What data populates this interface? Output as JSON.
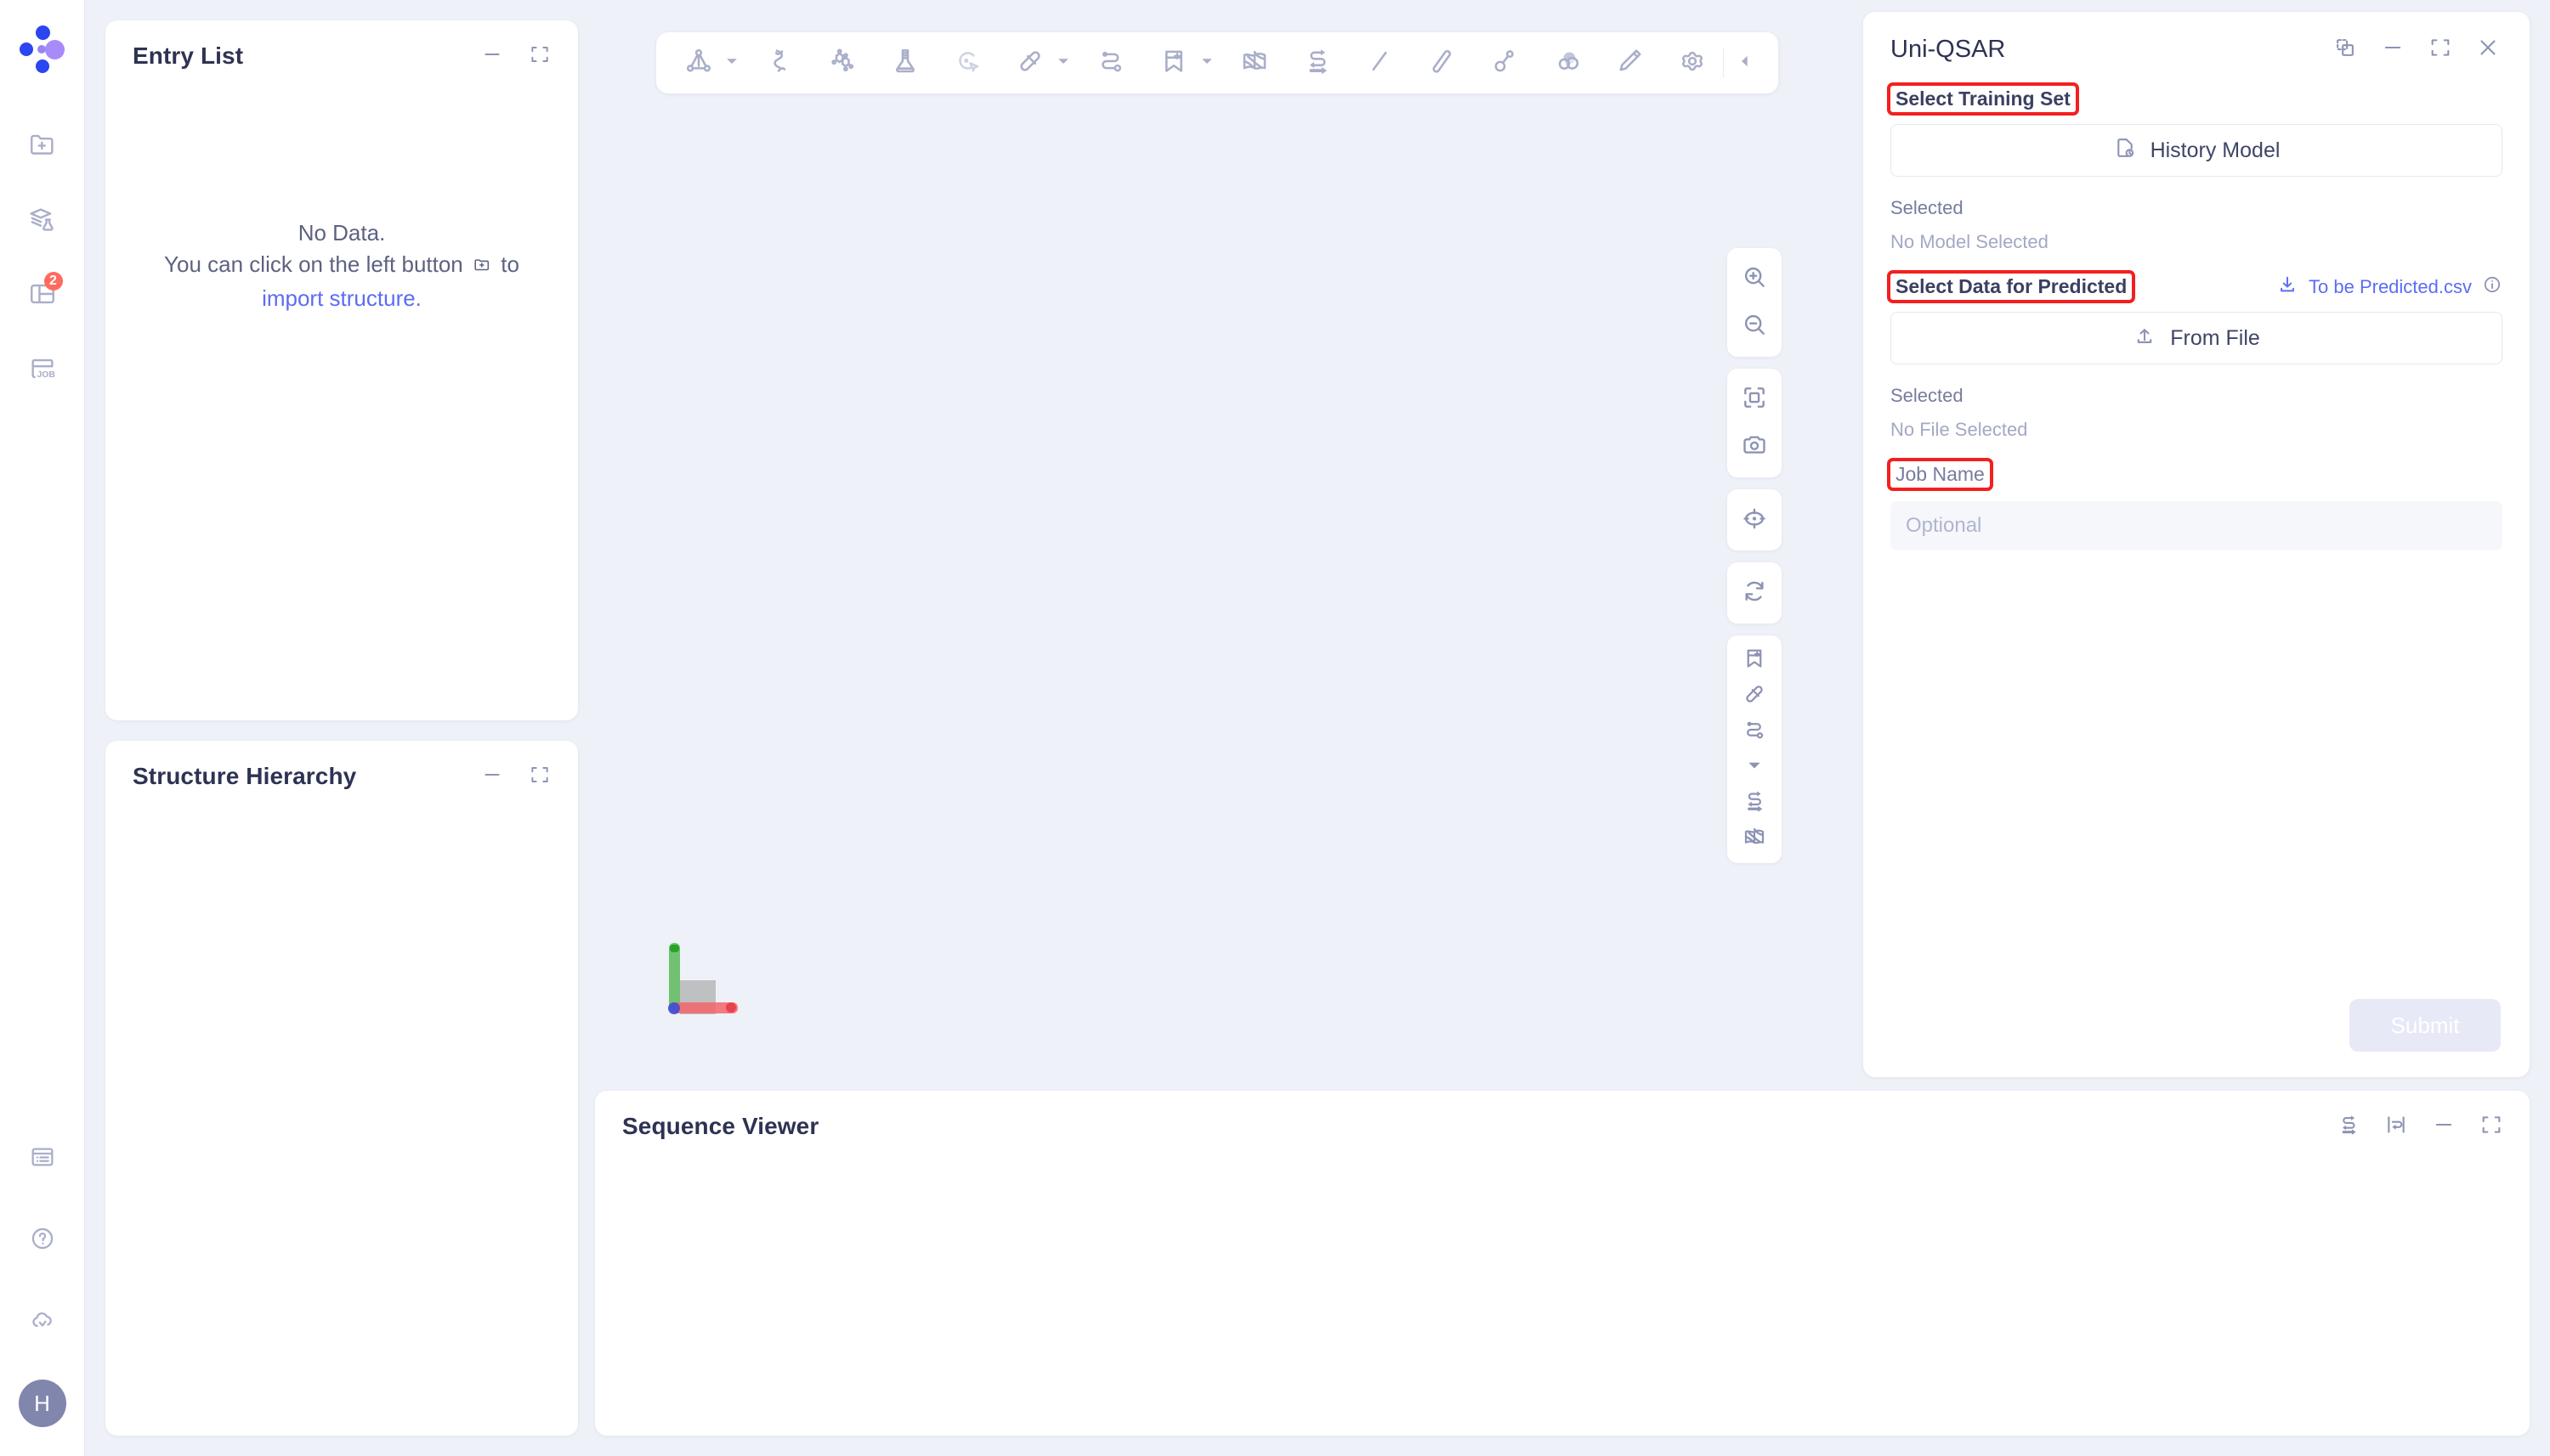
{
  "app": {
    "brand": "uni-logo",
    "background_color": "#eef1f7",
    "accent_color": "#5b6cf5",
    "highlight_color": "#f41f1f"
  },
  "left_rail": {
    "items": [
      {
        "name": "import-structure",
        "icon": "folder-plus-icon",
        "badge": ""
      },
      {
        "name": "learning",
        "icon": "graduation-flask-icon",
        "badge": ""
      },
      {
        "name": "projects",
        "icon": "layout-panel-icon",
        "badge": "2"
      },
      {
        "name": "jobs",
        "icon": "job-icon",
        "badge": ""
      }
    ],
    "bottom_items": [
      {
        "name": "notes",
        "icon": "list-window-icon"
      },
      {
        "name": "help",
        "icon": "question-circle-icon"
      },
      {
        "name": "cloud-sync",
        "icon": "cloud-check-icon"
      }
    ],
    "avatar_initial": "H"
  },
  "entry_list": {
    "title": "Entry List",
    "empty_line1": "No Data.",
    "empty_line2_before": "You can click on the left button",
    "empty_line2_after": "to",
    "empty_link": "import structure.",
    "minimize_icon": "minimize-icon",
    "expand_icon": "expand-icon"
  },
  "structure_hierarchy": {
    "title": "Structure Hierarchy",
    "minimize_icon": "minimize-icon",
    "expand_icon": "expand-icon"
  },
  "sequence_viewer": {
    "title": "Sequence Viewer",
    "actions": [
      {
        "name": "swap-icon"
      },
      {
        "name": "wrap-line-icon"
      },
      {
        "name": "minimize-icon"
      },
      {
        "name": "expand-icon"
      }
    ]
  },
  "toolbar": {
    "items": [
      {
        "name": "molecule-style-tool",
        "icon": "ball-stick-icon",
        "caret": true
      },
      {
        "name": "protein-ribbon-tool",
        "icon": "ribbon-icon",
        "caret": false
      },
      {
        "name": "ligand-tool",
        "icon": "hexagon-ring-icon",
        "caret": false
      },
      {
        "name": "flask-tool",
        "icon": "flask-icon",
        "caret": false
      },
      {
        "name": "select-tool",
        "icon": "select-pointer-icon",
        "caret": false
      },
      {
        "name": "measure-tool",
        "icon": "ruler-icon",
        "caret": true
      },
      {
        "name": "path-tool",
        "icon": "path-node-icon",
        "caret": false
      },
      {
        "name": "bookmark-add-tool",
        "icon": "bookmark-plus-icon",
        "caret": true
      },
      {
        "name": "surface-tool",
        "icon": "mesh-surface-icon",
        "caret": false
      },
      {
        "name": "transform-tool",
        "icon": "swap-arrows-icon",
        "caret": false
      },
      {
        "name": "line-tool",
        "icon": "line-icon",
        "caret": false
      },
      {
        "name": "stick-tool",
        "icon": "stick-icon",
        "caret": false
      },
      {
        "name": "bond-tool",
        "icon": "bond-icon",
        "caret": false
      },
      {
        "name": "sphere-tool",
        "icon": "spheres-icon",
        "caret": false
      },
      {
        "name": "edit-tool",
        "icon": "pencil-icon",
        "caret": false
      },
      {
        "name": "settings-tool",
        "icon": "gear-icon",
        "caret": false
      }
    ],
    "collapse": {
      "name": "collapse-toolbar",
      "icon": "chevron-left-icon"
    }
  },
  "viewport_tools": {
    "groups": [
      {
        "items": [
          {
            "name": "zoom-in",
            "icon": "zoom-in-icon"
          },
          {
            "name": "zoom-out",
            "icon": "zoom-out-icon"
          }
        ]
      },
      {
        "items": [
          {
            "name": "fit-to-screen",
            "icon": "fit-screen-icon"
          },
          {
            "name": "screenshot",
            "icon": "camera-icon"
          }
        ]
      },
      {
        "items": [
          {
            "name": "center-target",
            "icon": "crosshair-icon"
          }
        ]
      },
      {
        "items": [
          {
            "name": "reset-view",
            "icon": "refresh-icon"
          }
        ]
      },
      {
        "items": [
          {
            "name": "bookmark-add",
            "icon": "bookmark-plus-icon"
          },
          {
            "name": "measure",
            "icon": "ruler-icon"
          },
          {
            "name": "path",
            "icon": "path-node-icon"
          },
          {
            "name": "more-options",
            "icon": "caret-down-icon"
          },
          {
            "name": "transform",
            "icon": "swap-arrows-icon"
          },
          {
            "name": "surface",
            "icon": "mesh-surface-icon"
          }
        ]
      }
    ]
  },
  "axis_gizmo": {
    "x_axis_color": "#f2656b",
    "y_axis_color": "#5cb85c",
    "z_axis_color": "#3b4fd6",
    "box_color": "#b4b4b4"
  },
  "right_panel": {
    "title": "Uni-QSAR",
    "actions": [
      {
        "name": "pop-out-icon"
      },
      {
        "name": "minimize-icon"
      },
      {
        "name": "expand-icon"
      },
      {
        "name": "close-icon"
      }
    ],
    "training_set": {
      "label": "Select Training Set",
      "highlighted": true,
      "button_label": "History Model",
      "button_icon": "file-clock-icon",
      "selected_label": "Selected",
      "selected_value": "No Model Selected"
    },
    "predict_data": {
      "label": "Select Data for Predicted",
      "highlighted": true,
      "template_link": "To be Predicted.csv",
      "template_icon": "download-icon",
      "info_icon": "info-icon",
      "button_label": "From File",
      "button_icon": "upload-icon",
      "selected_label": "Selected",
      "selected_value": "No File Selected"
    },
    "job_name": {
      "label": "Job Name",
      "highlighted": true,
      "placeholder": "Optional",
      "value": ""
    },
    "submit_label": "Submit"
  }
}
